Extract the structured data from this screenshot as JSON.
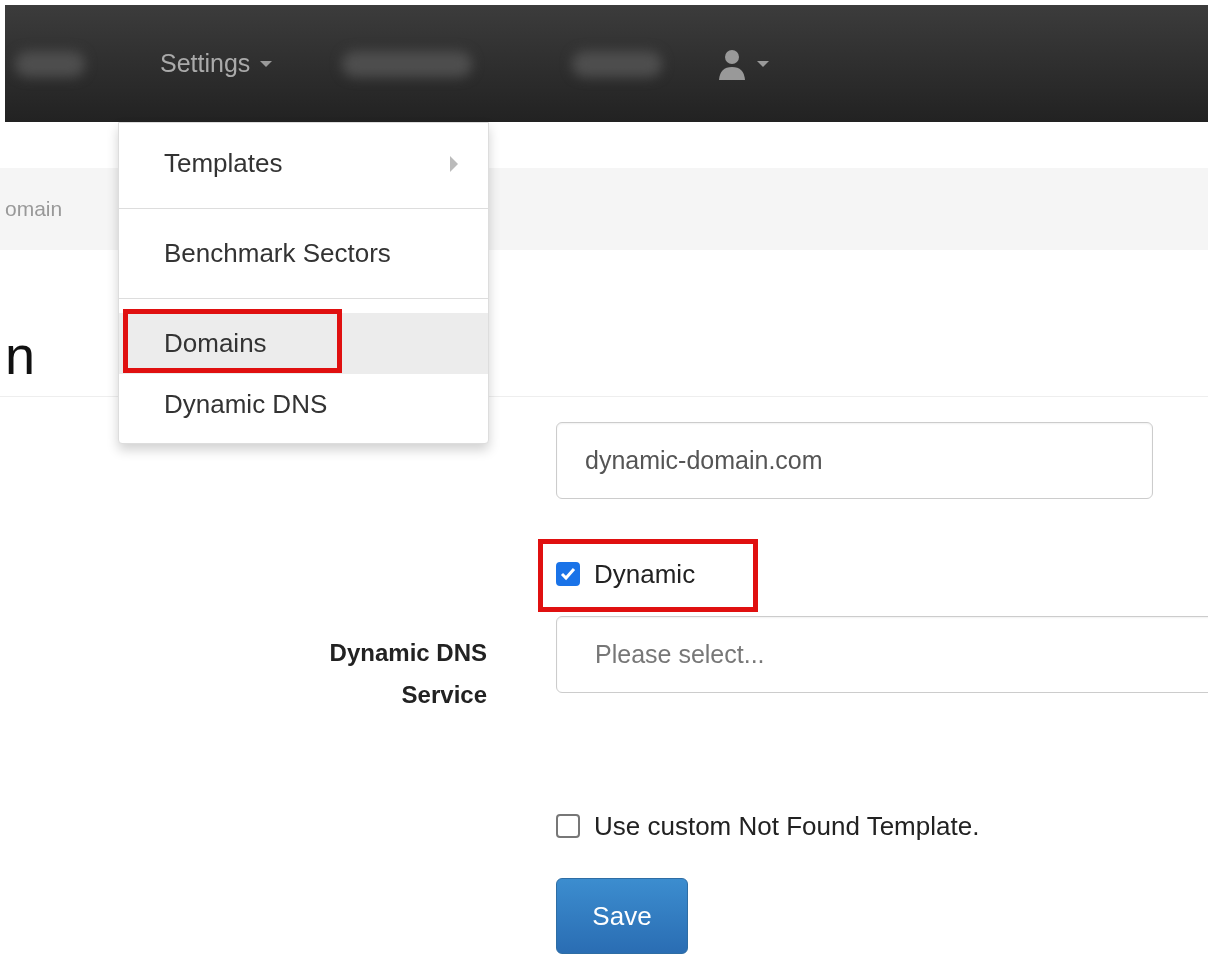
{
  "navbar": {
    "items": [
      {
        "kind": "blurred"
      },
      {
        "kind": "menu",
        "label": "Settings",
        "expanded": true
      },
      {
        "kind": "blurred"
      },
      {
        "kind": "blurred"
      },
      {
        "kind": "user"
      }
    ]
  },
  "dropdown": {
    "items": [
      {
        "label": "Templates",
        "submenu": true,
        "selected": false,
        "annotated": false
      },
      {
        "kind": "divider"
      },
      {
        "label": "Benchmark Sectors",
        "submenu": false,
        "selected": false,
        "annotated": false
      },
      {
        "kind": "divider"
      },
      {
        "label": "Domains",
        "submenu": false,
        "selected": true,
        "annotated": true
      },
      {
        "label": "Dynamic DNS",
        "submenu": false,
        "selected": false,
        "annotated": false
      }
    ]
  },
  "breadcrumb": "omain",
  "heading": "n",
  "form": {
    "fields": [
      {
        "kind": "text",
        "value": "dynamic-domain.com"
      },
      {
        "kind": "checkbox",
        "label": "Dynamic",
        "checked": true,
        "annotated": true
      },
      {
        "kind": "select",
        "label": "Dynamic DNS Service",
        "placeholder": "Please select..."
      },
      {
        "kind": "checkbox",
        "label": "Use custom Not Found Template.",
        "checked": false,
        "annotated": false
      }
    ],
    "submit": "Save"
  }
}
